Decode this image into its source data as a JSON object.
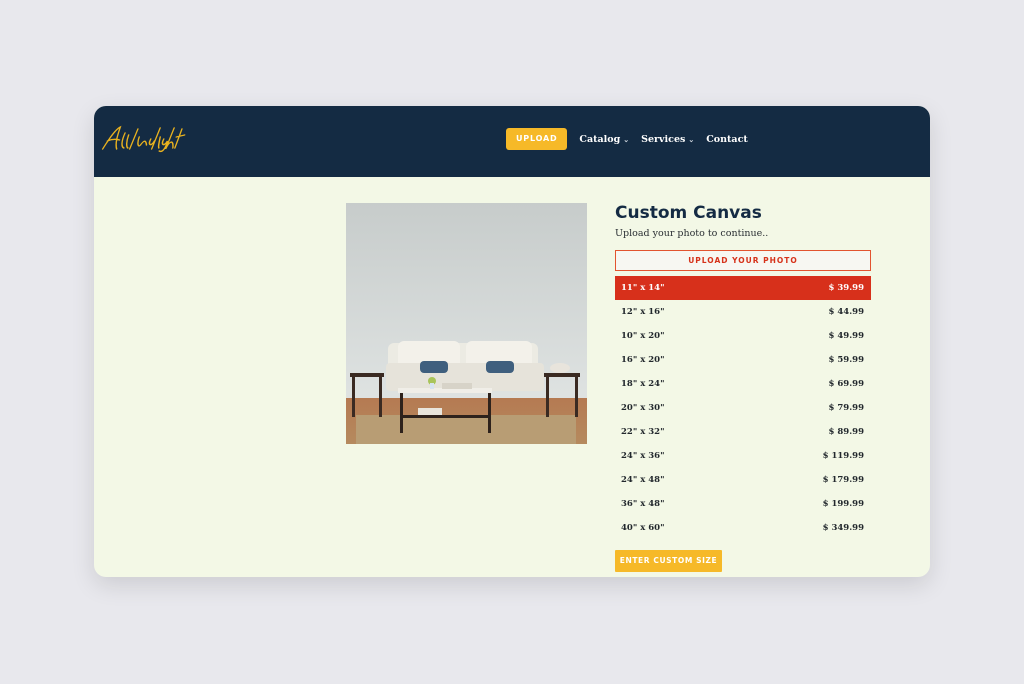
{
  "brand": {
    "logo_text": "Art Insight"
  },
  "nav": {
    "upload_label": "UPLOAD",
    "items": [
      {
        "label": "Catalog",
        "has_dropdown": true
      },
      {
        "label": "Services",
        "has_dropdown": true
      },
      {
        "label": "Contact",
        "has_dropdown": false
      }
    ]
  },
  "product": {
    "title": "Custom Canvas",
    "subtitle": "Upload your photo to continue..",
    "upload_photo_label": "UPLOAD YOUR PHOTO",
    "sizes": [
      {
        "size": "11\" x 14\"",
        "price": "$ 39.99",
        "selected": true
      },
      {
        "size": "12\" x 16\"",
        "price": "$ 44.99",
        "selected": false
      },
      {
        "size": "10\" x 20\"",
        "price": "$ 49.99",
        "selected": false
      },
      {
        "size": "16\" x 20\"",
        "price": "$ 59.99",
        "selected": false
      },
      {
        "size": "18\" x 24\"",
        "price": "$ 69.99",
        "selected": false
      },
      {
        "size": "20\" x 30\"",
        "price": "$ 79.99",
        "selected": false
      },
      {
        "size": "22\" x 32\"",
        "price": "$ 89.99",
        "selected": false
      },
      {
        "size": "24\" x 36\"",
        "price": "$ 119.99",
        "selected": false
      },
      {
        "size": "24\" x 48\"",
        "price": "$ 179.99",
        "selected": false
      },
      {
        "size": "36\" x 48\"",
        "price": "$ 199.99",
        "selected": false
      },
      {
        "size": "40\" x 60\"",
        "price": "$ 349.99",
        "selected": false
      }
    ],
    "custom_size_label": "ENTER CUSTOM SIZE"
  },
  "colors": {
    "header_bg": "#142b43",
    "accent_yellow": "#f6b928",
    "accent_red": "#d7301b",
    "page_bg": "#f3f8e6"
  }
}
